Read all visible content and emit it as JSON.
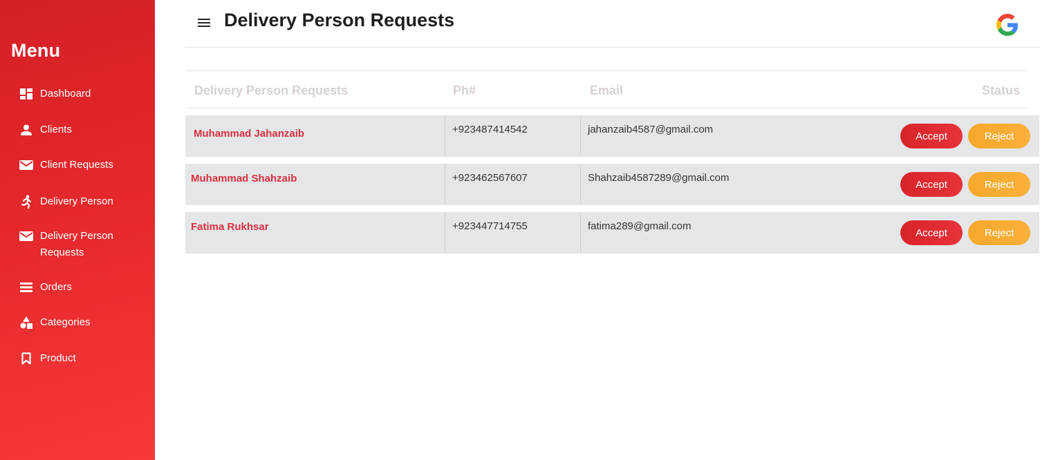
{
  "sidebar": {
    "title": "Menu",
    "items": [
      {
        "label": "Dashboard",
        "icon": "dashboard-icon"
      },
      {
        "label": "Clients",
        "icon": "person-icon"
      },
      {
        "label": "Client Requests",
        "icon": "mail-icon"
      },
      {
        "label": "Delivery Person",
        "icon": "running-person-icon"
      },
      {
        "label": "Delivery Person Requests",
        "icon": "mail-icon"
      },
      {
        "label": "Orders",
        "icon": "list-icon"
      },
      {
        "label": "Categories",
        "icon": "categories-icon"
      },
      {
        "label": "Product",
        "icon": "bookmark-icon"
      }
    ]
  },
  "header": {
    "title": "Delivery Person Requests",
    "menu_icon": "hamburger-icon",
    "account_icon": "google-icon"
  },
  "table": {
    "columns": [
      "Delivery Person Requests",
      "Ph#",
      "Email",
      "Status"
    ],
    "rows": [
      {
        "name": "Muhammad Jahanzaib",
        "phone": "+923487414542",
        "email": "jahanzaib4587@gmail.com",
        "accept": "Accept",
        "reject": "Reject"
      },
      {
        "name": "Muhammad Shahzaib",
        "phone": "+923462567607",
        "email": "Shahzaib4587289@gmail.com",
        "accept": "Accept",
        "reject": "Reject"
      },
      {
        "name": "Fatima Rukhsar",
        "phone": "+923447714755",
        "email": "fatima289@gmail.com",
        "accept": "Accept",
        "reject": "Reject"
      }
    ]
  },
  "colors": {
    "sidebar_start": "#d42026",
    "sidebar_end": "#f8393a",
    "accept": "#d9232a",
    "reject": "#fbb03b",
    "name_text": "#d93040",
    "row_bg": "#e5e6e8"
  }
}
